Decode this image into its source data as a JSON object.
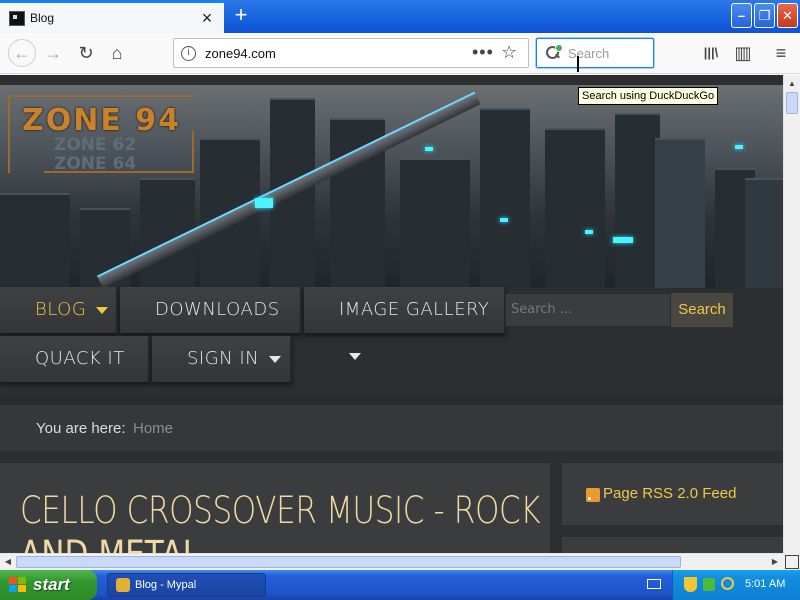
{
  "browser": {
    "tab_title": "Blog",
    "url": "zone94.com",
    "search_placeholder": "Search",
    "tooltip": "Search using DuckDuckGo",
    "icons": {
      "tab_close": "×",
      "new_tab": "+",
      "back": "←",
      "forward": "→",
      "reload": "↻",
      "home": "⌂",
      "page_actions": "•••",
      "bookmark": "☆",
      "library": "|||\\",
      "sidebar": "▥",
      "menu": "≡",
      "win_min": "–",
      "win_max": "❐",
      "win_close": "✕"
    }
  },
  "site": {
    "logo_main": "ZONE 94",
    "logo_sub1": "ZONE 62",
    "logo_sub2": "ZONE 64",
    "menu": [
      {
        "label": "BLOG",
        "has_dropdown": true,
        "active": true
      },
      {
        "label": "DOWNLOADS",
        "has_dropdown": true
      },
      {
        "label": "IMAGE GALLERY",
        "has_dropdown": true
      },
      {
        "label": "QUACK IT",
        "has_dropdown": false
      },
      {
        "label": "SIGN IN",
        "has_dropdown": true
      }
    ],
    "search_placeholder": "Search ...",
    "search_button": "Search",
    "breadcrumb_label": "You are here:",
    "breadcrumb_home": "Home",
    "article_title_line1": "CELLO CROSSOVER MUSIC - ROCK",
    "article_title_line2": "AND METAL",
    "rss_link": "Page RSS 2.0 Feed",
    "colors": {
      "accent": "#f0c84a",
      "page_bg": "#2d2e2f",
      "title": "#f0d9a6"
    }
  },
  "taskbar": {
    "start_label": "start",
    "task_label": "Blog - Mypal",
    "clock": "5:01 AM"
  }
}
